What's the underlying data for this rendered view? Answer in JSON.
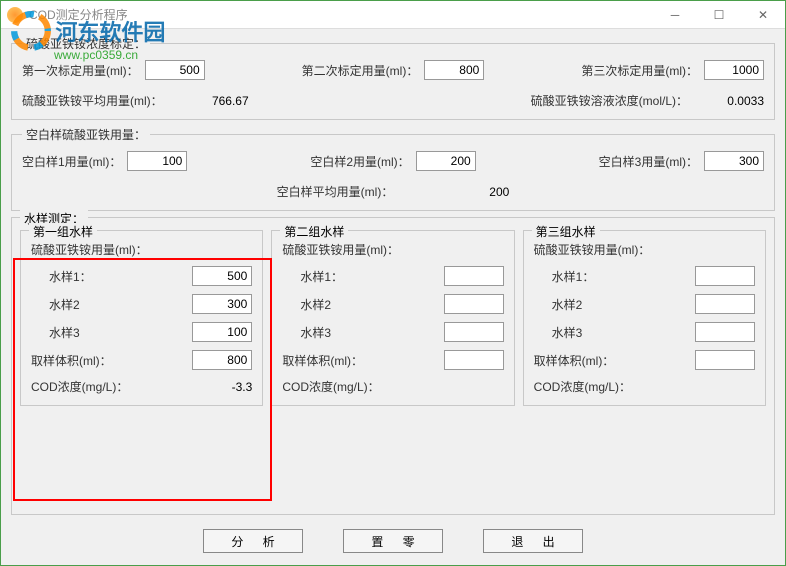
{
  "window": {
    "title": "COD测定分析程序"
  },
  "watermark": {
    "line1": "河东软件园",
    "line2": "www.pc0359.cn"
  },
  "calibration": {
    "legend": "硫酸亚铁铵浓度标定：",
    "first_label": "第一次标定用量(ml)：",
    "first_value": "500",
    "second_label": "第二次标定用量(ml)：",
    "second_value": "800",
    "third_label": "第三次标定用量(ml)：",
    "third_value": "1000",
    "avg_label": "硫酸亚铁铵平均用量(ml)：",
    "avg_value": "766.67",
    "conc_label": "硫酸亚铁铵溶液浓度(mol/L)：",
    "conc_value": "0.0033"
  },
  "blank": {
    "legend": "空白样硫酸亚铁用量：",
    "b1_label": "空白样1用量(ml)：",
    "b1_value": "100",
    "b2_label": "空白样2用量(ml)：",
    "b2_value": "200",
    "b3_label": "空白样3用量(ml)：",
    "b3_value": "300",
    "avg_label": "空白样平均用量(ml)：",
    "avg_value": "200"
  },
  "samples": {
    "legend": "水样测定：",
    "usage_label": "硫酸亚铁铵用量(ml)：",
    "s1_label": "水样1：",
    "s2_label": "水样2",
    "s3_label": "水样3",
    "vol_label": "取样体积(ml)：",
    "cod_label": "COD浓度(mg/L)：",
    "groups": [
      {
        "legend": "第一组水样",
        "s1": "500",
        "s2": "300",
        "s3": "100",
        "vol": "800",
        "cod": "-3.3"
      },
      {
        "legend": "第二组水样",
        "s1": "",
        "s2": "",
        "s3": "",
        "vol": "",
        "cod": ""
      },
      {
        "legend": "第三组水样",
        "s1": "",
        "s2": "",
        "s3": "",
        "vol": "",
        "cod": ""
      }
    ]
  },
  "buttons": {
    "analyze": "分 析",
    "reset": "置 零",
    "exit": "退 出"
  }
}
